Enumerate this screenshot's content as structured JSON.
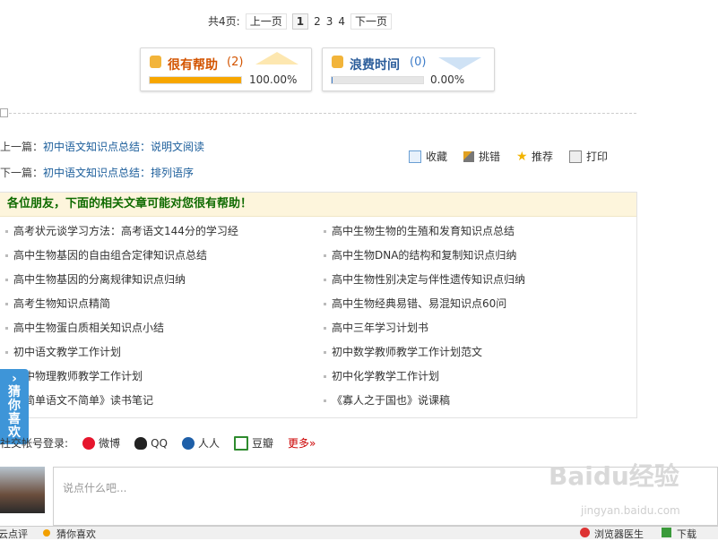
{
  "pager": {
    "total": "共4页:",
    "prev": "上一页",
    "pages": [
      "1",
      "2",
      "3",
      "4"
    ],
    "next": "下一页"
  },
  "votes": {
    "helpful": {
      "label": "很有帮助",
      "count": "(2)",
      "percent": "100.00%",
      "fill": 1.0,
      "color": "#f7a600"
    },
    "waste": {
      "label": "浪费时间",
      "count": "(0)",
      "percent": "0.00%",
      "fill": 0.0,
      "color": "#3d7cc9"
    }
  },
  "article_nav": {
    "prev_label": "上一篇：",
    "prev_title": "初中语文知识点总结：说明文阅读",
    "next_label": "下一篇：",
    "next_title": "初中语文知识点总结：排列语序"
  },
  "tools": [
    "收藏",
    "挑错",
    "推荐",
    "打印"
  ],
  "related": {
    "heading": "各位朋友，下面的相关文章可能对您很有帮助！",
    "left": [
      "高考状元谈学习方法：高考语文144分的学习经",
      "高中生物基因的自由组合定律知识点总结",
      "高中生物基因的分离规律知识点归纳",
      "高考生物知识点精简",
      "高中生物蛋白质相关知识点小结",
      "初中语文教学工作计划",
      "初中物理教师教学工作计划",
      "《简单语文不简单》读书笔记"
    ],
    "right": [
      "高中生物生物的生殖和发育知识点总结",
      "高中生物DNA的结构和复制知识点归纳",
      "高中生物性别决定与伴性遗传知识点归纳",
      "高中生物经典易错、易混知识点60问",
      "高中三年学习计划书",
      "初中数学教师教学工作计划范文",
      "初中化学教学工作计划",
      "《寡人之于国也》说课稿"
    ]
  },
  "sidetab": {
    "arrow": "›",
    "text": "猜你喜欢"
  },
  "social": {
    "label": "社交帐号登录:",
    "weibo": "微博",
    "qq": "QQ",
    "renren": "人人",
    "douban": "豆瓣",
    "more": "更多»"
  },
  "comment": {
    "placeholder": "说点什么吧..."
  },
  "bottombar": {
    "left": "云点评",
    "guess": "猜你喜欢",
    "doctor": "浏览器医生",
    "download": "下载"
  },
  "watermark": {
    "brand": "Baidu经验",
    "url": "jingyan.baidu.com"
  }
}
